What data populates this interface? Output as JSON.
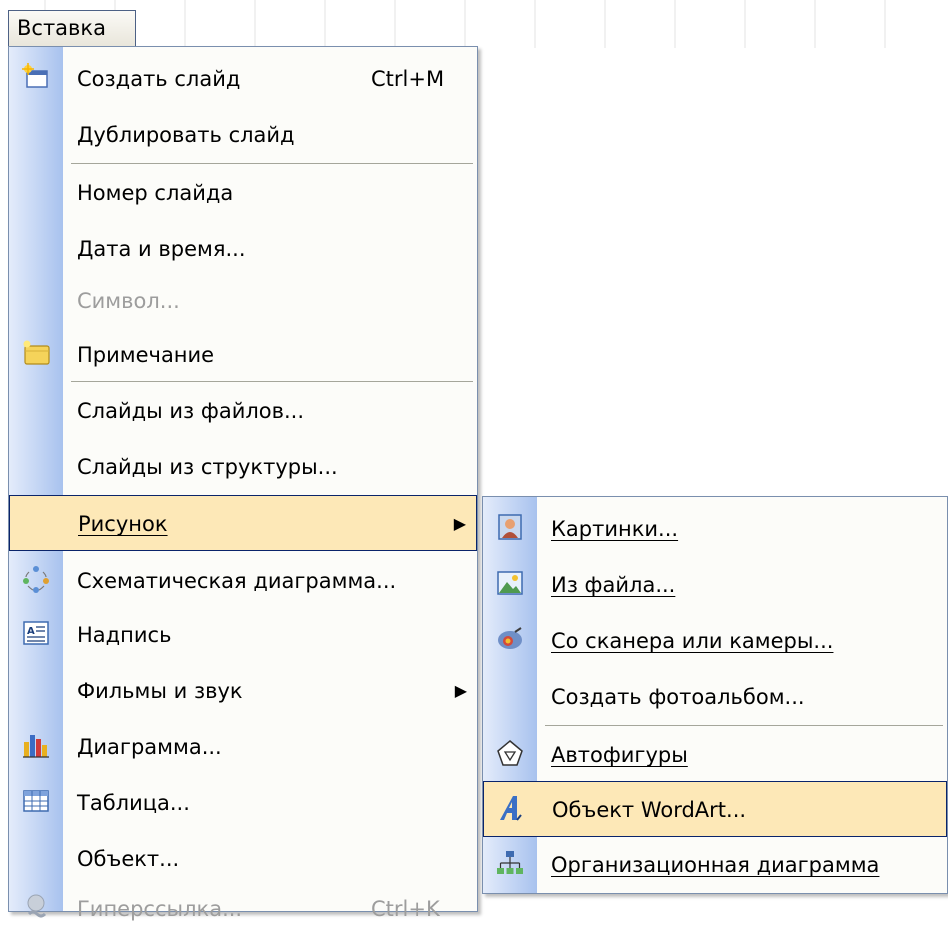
{
  "menubar": {
    "active_menu": "Вставка"
  },
  "main_menu": {
    "items": [
      {
        "label": "Создать слайд",
        "shortcut": "Ctrl+M",
        "icon": "new-slide-icon",
        "enabled": true
      },
      {
        "label": "Дублировать слайд",
        "enabled": true
      },
      {
        "label": "Номер слайда",
        "enabled": true
      },
      {
        "label": "Дата и время...",
        "enabled": true
      },
      {
        "label": "Символ...",
        "enabled": false
      },
      {
        "label": "Примечание",
        "icon": "comment-icon",
        "enabled": true
      },
      {
        "label": "Слайды из файлов...",
        "enabled": true
      },
      {
        "label": "Слайды из структуры...",
        "enabled": true
      },
      {
        "label": "Рисунок",
        "submenu": true,
        "highlighted": true,
        "enabled": true
      },
      {
        "label": "Схематическая диаграмма...",
        "icon": "diagram-icon",
        "enabled": true
      },
      {
        "label": "Надпись",
        "icon": "textbox-icon",
        "enabled": true
      },
      {
        "label": "Фильмы и звук",
        "submenu": true,
        "enabled": true
      },
      {
        "label": "Диаграмма...",
        "icon": "chart-icon",
        "enabled": true
      },
      {
        "label": "Таблица...",
        "icon": "table-icon",
        "enabled": true
      },
      {
        "label": "Объект...",
        "enabled": true
      },
      {
        "label": "Гиперссылка...",
        "shortcut": "Ctrl+K",
        "icon": "hyperlink-icon",
        "enabled": false
      }
    ]
  },
  "picture_submenu": {
    "items": [
      {
        "label": "Картинки...",
        "icon": "clipart-icon"
      },
      {
        "label": "Из файла...",
        "icon": "picture-from-file-icon"
      },
      {
        "label": "Со сканера или камеры...",
        "icon": "scanner-camera-icon"
      },
      {
        "label": "Создать фотоальбом..."
      },
      {
        "label": "Автофигуры",
        "icon": "autoshapes-icon"
      },
      {
        "label": "Объект WordArt...",
        "icon": "wordart-icon",
        "highlighted": true
      },
      {
        "label": "Организационная диаграмма",
        "icon": "org-chart-icon"
      }
    ]
  },
  "colors": {
    "highlight_fill": "#fde8b7",
    "highlight_border": "#0a246a",
    "gutter_light": "#e4ecfb",
    "gutter_dark": "#a8c2ee",
    "disabled_text": "#9d9d9d"
  }
}
